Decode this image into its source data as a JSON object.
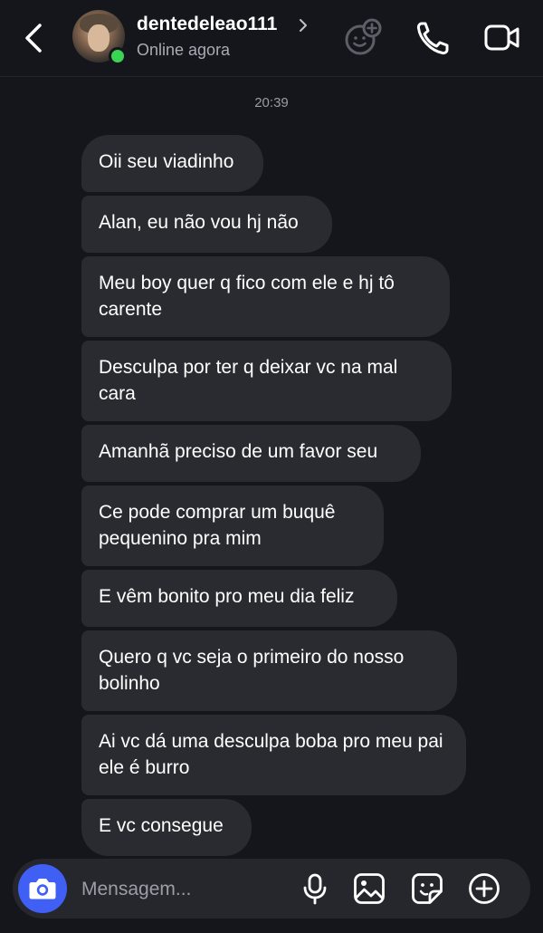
{
  "header": {
    "username": "dentedeleao111",
    "status": "Online agora",
    "back_icon": "chevron-left-icon",
    "profile_chevron_icon": "chevron-right-icon",
    "effects_icon": "face-plus-icon",
    "call_icon": "phone-icon",
    "video_icon": "video-camera-icon"
  },
  "chat": {
    "timestamp": "20:39",
    "messages": [
      {
        "text": "Oii seu viadinho"
      },
      {
        "text": "Alan, eu não vou hj não"
      },
      {
        "text": "Meu boy quer q fico com ele e hj tô carente"
      },
      {
        "text": "Desculpa por ter q deixar vc na mal cara"
      },
      {
        "text": "Amanhã preciso de um favor seu"
      },
      {
        "text": "Ce pode comprar um buquê pequenino pra mim"
      },
      {
        "text": "E vêm bonito pro meu dia feliz"
      },
      {
        "text": "Quero q vc seja o primeiro do nosso bolinho"
      },
      {
        "text": "Ai vc dá uma desculpa boba pro meu pai ele é burro"
      },
      {
        "text": "E vc consegue"
      }
    ]
  },
  "composer": {
    "placeholder": "Mensagem...",
    "camera_icon": "camera-icon",
    "mic_icon": "microphone-icon",
    "gallery_icon": "image-icon",
    "sticker_icon": "sticker-icon",
    "add_icon": "plus-circle-icon"
  },
  "colors": {
    "background": "#15161c",
    "bubble": "#2a2b31",
    "accent": "#3f5ff5",
    "online": "#3ad353"
  }
}
